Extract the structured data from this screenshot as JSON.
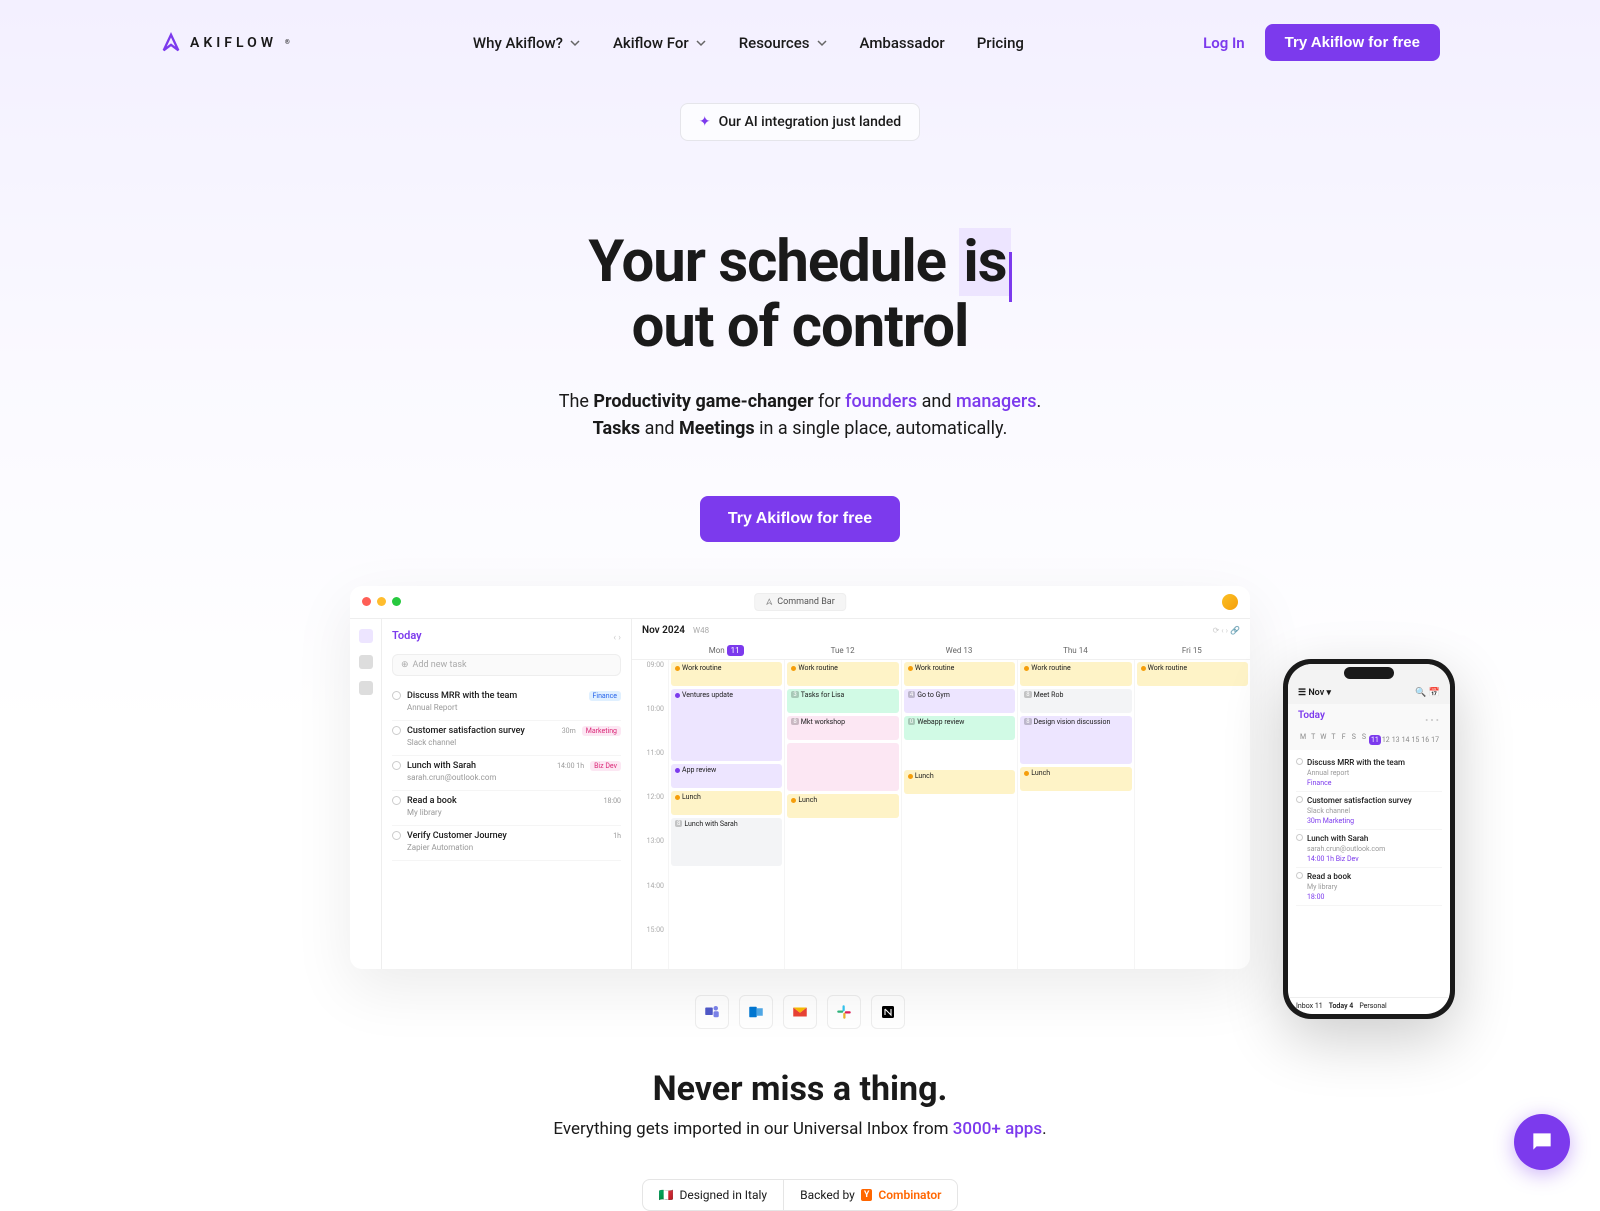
{
  "brand": "AKIFLOW",
  "nav": {
    "items": [
      "Why Akiflow?",
      "Akiflow For",
      "Resources",
      "Ambassador",
      "Pricing"
    ]
  },
  "header": {
    "login": "Log In",
    "cta": "Try Akiflow for free"
  },
  "ai_badge": "Our AI integration just landed",
  "hero": {
    "line1a": "Your schedule ",
    "line1b": "is",
    "line2": "out of control",
    "sub_prefix": "The ",
    "sub_bold1": "Productivity game-changer",
    "sub_mid1": " for ",
    "sub_purple1": "founders",
    "sub_and": " and ",
    "sub_purple2": "managers",
    "sub_period": ".",
    "sub2_bold1": "Tasks",
    "sub2_and": " and ",
    "sub2_bold2": "Meetings",
    "sub2_rest": " in a single place, automatically.",
    "cta": "Try Akiflow for free"
  },
  "mockup": {
    "command_bar": "Command Bar",
    "left_title": "Today",
    "add_task": "Add new task",
    "month": "Nov 2024",
    "week": "W48",
    "days": [
      "Mon 11",
      "Tue 12",
      "Wed 13",
      "Thu 14",
      "Fri 15"
    ],
    "times": [
      "09:00",
      "10:00",
      "11:00",
      "12:00",
      "13:00",
      "14:00",
      "15:00"
    ],
    "tasks": [
      {
        "title": "Discuss MRR with the team",
        "sub": "Annual Report",
        "tag": "Finance",
        "tag_color": "#e0f0ff",
        "tag_text": "#2563eb"
      },
      {
        "title": "Customer satisfaction survey",
        "sub": "Slack channel",
        "tag": "Marketing",
        "tag_color": "#fce7f3",
        "tag_text": "#db2777",
        "time": "30m"
      },
      {
        "title": "Lunch with Sarah",
        "sub": "sarah.crun@outlook.com",
        "tag": "Biz Dev",
        "tag_color": "#fce7f3",
        "tag_text": "#db2777",
        "time": "14:00  1h"
      },
      {
        "title": "Read a book",
        "sub": "My library",
        "time": "18:00"
      },
      {
        "title": "Verify Customer Journey",
        "sub": "Zapier Automation",
        "time": "1h"
      }
    ],
    "events": {
      "mon": [
        {
          "t": "Work routine",
          "c": "#fef3c7",
          "d": "#f59e0b"
        },
        {
          "t": "Ventures update",
          "c": "#ede5ff",
          "d": "#7c3aed",
          "h": 3
        },
        {
          "t": "App review",
          "c": "#ede5ff",
          "d": "#7c3aed"
        },
        {
          "t": "Lunch",
          "c": "#fef3c7",
          "d": "#f59e0b"
        },
        {
          "t": "Lunch with Sarah",
          "c": "#f3f4f6",
          "d": "#888",
          "h": 2,
          "badge": "8"
        }
      ],
      "tue": [
        {
          "t": "Work routine",
          "c": "#fef3c7",
          "d": "#f59e0b"
        },
        {
          "t": "Tasks for Lisa",
          "c": "#d1fae5",
          "d": "#10b981",
          "badge": "3"
        },
        {
          "t": "Mkt workshop",
          "c": "#fce7f3",
          "d": "#ec4899",
          "badge": "8"
        },
        {
          "t": "",
          "c": "#fce7f3",
          "h": 2
        },
        {
          "t": "Lunch",
          "c": "#fef3c7",
          "d": "#f59e0b"
        }
      ],
      "wed": [
        {
          "t": "Work routine",
          "c": "#fef3c7",
          "d": "#f59e0b"
        },
        {
          "t": "Go to Gym",
          "c": "#ede5ff",
          "d": "#7c3aed",
          "badge": "4"
        },
        {
          "t": "Webapp review",
          "c": "#d1fae5",
          "d": "#10b981",
          "badge": "0"
        },
        {
          "t": "",
          "c": "transparent",
          "h": 1
        },
        {
          "t": "Lunch",
          "c": "#fef3c7",
          "d": "#f59e0b"
        }
      ],
      "thu": [
        {
          "t": "Work routine",
          "c": "#fef3c7",
          "d": "#f59e0b"
        },
        {
          "t": "Meet Rob",
          "c": "#f3f4f6",
          "d": "#888",
          "badge": "8"
        },
        {
          "t": "Design vision discussion",
          "c": "#ede5ff",
          "d": "#7c3aed",
          "h": 2,
          "badge": "8"
        },
        {
          "t": "Lunch",
          "c": "#fef3c7",
          "d": "#f59e0b"
        }
      ],
      "fri": [
        {
          "t": "Work routine",
          "c": "#fef3c7",
          "d": "#f59e0b"
        }
      ]
    }
  },
  "phone": {
    "month": "Nov",
    "today": "Today",
    "week_letters": [
      "M",
      "T",
      "W",
      "T",
      "F",
      "S",
      "S"
    ],
    "week_nums": [
      "11",
      "12",
      "13",
      "14",
      "15",
      "16",
      "17"
    ],
    "tasks": [
      {
        "title": "Discuss MRR with the team",
        "sub": "Annual report",
        "tag": "Finance"
      },
      {
        "title": "Customer satisfaction survey",
        "sub": "Slack channel",
        "tags": "30m  Marketing"
      },
      {
        "title": "Lunch with Sarah",
        "sub": "sarah.crun@outlook.com",
        "tags": "14:00  1h  Biz Dev"
      },
      {
        "title": "Read a book",
        "sub": "My library",
        "tags": "18:00"
      }
    ],
    "footer": [
      "Inbox 11",
      "Today 4",
      "Personal"
    ]
  },
  "integrations": [
    "teams",
    "outlook",
    "gmail",
    "slack",
    "notion"
  ],
  "never_miss": {
    "title": "Never miss a thing.",
    "text_pre": "Everything gets imported in our Universal Inbox from ",
    "text_purple": "3000+ apps",
    "text_suf": "."
  },
  "footer": {
    "italy": "Designed in Italy",
    "backed": "Backed by",
    "yc": "Combinator"
  }
}
